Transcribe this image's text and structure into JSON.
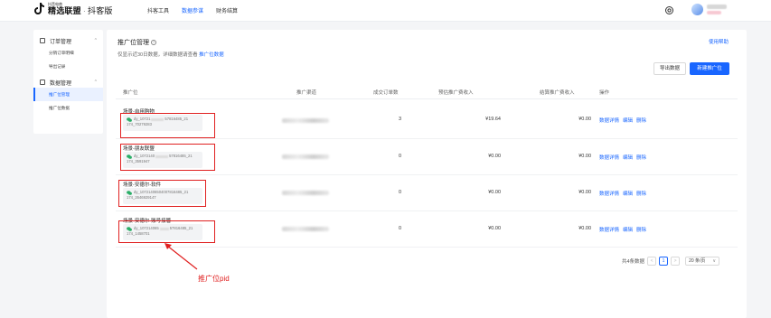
{
  "header": {
    "logo_small": "抖音电商",
    "logo_main": "精选联盟",
    "logo_sep": "·",
    "logo_sub": "抖客版",
    "nav": [
      {
        "label": "抖客工具",
        "active": false
      },
      {
        "label": "数据参谋",
        "active": true
      },
      {
        "label": "财务结算",
        "active": false
      }
    ]
  },
  "sidebar": {
    "groups": [
      {
        "label": "订单管理",
        "items": [
          {
            "label": "分销订单明细",
            "active": false
          },
          {
            "label": "导出记录",
            "active": false
          }
        ]
      },
      {
        "label": "数据管理",
        "items": [
          {
            "label": "推广位管理",
            "active": true
          },
          {
            "label": "推广位数据",
            "active": false
          }
        ]
      }
    ]
  },
  "main": {
    "title": "推广位管理",
    "help_link": "使用帮助",
    "subtitle_prefix": "仅显示近30日数据，详细数据请查看",
    "subtitle_link": "推广位数据",
    "export_label": "导出数据",
    "new_label": "新建推广位",
    "columns": [
      "推广位",
      "推广渠道",
      "成交订单数",
      "预估推广费收入",
      "结算推广费收入",
      "操作"
    ],
    "rows": [
      {
        "name": "场景-自用购物",
        "pid1": "dy_10721",
        "pid1b": "57816485_21",
        "pid2": "174_70279283",
        "orders": "3",
        "est": "¥19.64",
        "settled": "¥0.00"
      },
      {
        "name": "场景-朋友联盟",
        "pid1": "dy_1072140",
        "pid1b": "57816485_21",
        "pid2": "174_3591947",
        "orders": "0",
        "est": "¥0.00",
        "settled": "¥0.00"
      },
      {
        "name": "场景-安德尔-软件",
        "pid1": "dy_107214065",
        "pid1b": "04007816485_21",
        "pid2": "174_2646929147",
        "orders": "0",
        "est": "¥0.00",
        "settled": "¥0.00"
      },
      {
        "name": "场景-安德尔-账号接管",
        "pid1": "dy_107214065",
        "pid1b": "57816485_21",
        "pid2": "174_1458701",
        "orders": "0",
        "est": "¥0.00",
        "settled": "¥0.00"
      }
    ],
    "ops": [
      "数据详情",
      "编辑",
      "删除"
    ],
    "pager": {
      "total": "共4条数据",
      "prev": "<",
      "page": "1",
      "next": ">",
      "size": "20 条/页",
      "size_arrow": "∨"
    }
  },
  "annotation": {
    "text": "推广位pid",
    "color": "#e02020"
  },
  "colors": {
    "accent": "#1966ff",
    "annotation_red": "#e02020"
  }
}
